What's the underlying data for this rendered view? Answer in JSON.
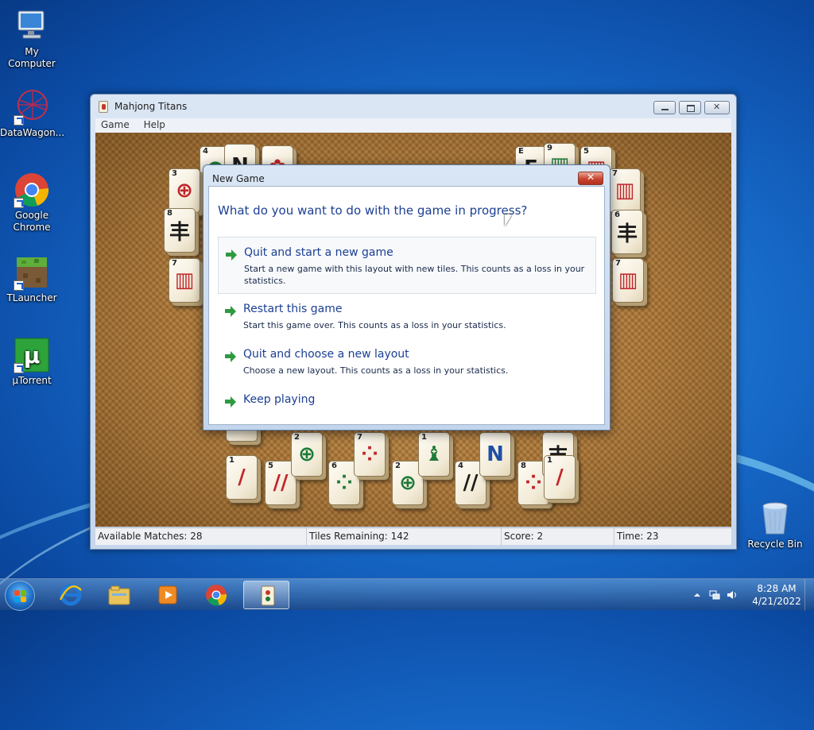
{
  "desktop": {
    "icons": [
      {
        "label": "My Computer"
      },
      {
        "label": "DataWagon..."
      },
      {
        "label": "Google Chrome"
      },
      {
        "label": "TLauncher"
      },
      {
        "label": "µTorrent"
      },
      {
        "label": "Recycle Bin"
      }
    ]
  },
  "window": {
    "title": "Mahjong Titans",
    "menu": [
      "Game",
      "Help"
    ]
  },
  "board": {
    "tiles": [
      {
        "num": "4",
        "glyph": "●",
        "color": "t-green"
      },
      {
        "num": "",
        "glyph": "N",
        "color": "t-black"
      },
      {
        "num": "",
        "glyph": "✿",
        "color": "t-red"
      },
      {
        "num": "3",
        "glyph": "⊕",
        "color": "t-red"
      },
      {
        "num": "8",
        "glyph": "丰",
        "color": "t-black"
      },
      {
        "num": "7",
        "glyph": "▥",
        "color": "t-red"
      },
      {
        "num": "E",
        "glyph": "E",
        "color": "t-black"
      },
      {
        "num": "9",
        "glyph": "▥",
        "color": "t-green"
      },
      {
        "num": "5",
        "glyph": "▥",
        "color": "t-red"
      },
      {
        "num": "7",
        "glyph": "▥",
        "color": "t-red"
      },
      {
        "num": "6",
        "glyph": "丰",
        "color": "t-black"
      },
      {
        "num": "7",
        "glyph": "▥",
        "color": "t-red"
      },
      {
        "num": "",
        "glyph": "▥",
        "color": "t-red"
      },
      {
        "num": "1",
        "glyph": "/",
        "color": "t-red"
      },
      {
        "num": "5",
        "glyph": "//",
        "color": "t-red"
      },
      {
        "num": "2",
        "glyph": "⊕",
        "color": "t-green"
      },
      {
        "num": "6",
        "glyph": "⁘",
        "color": "t-green"
      },
      {
        "num": "7",
        "glyph": "⁘",
        "color": "t-red"
      },
      {
        "num": "2",
        "glyph": "⊕",
        "color": "t-green"
      },
      {
        "num": "1",
        "glyph": "♝",
        "color": "t-green"
      },
      {
        "num": "4",
        "glyph": "//",
        "color": "t-black"
      },
      {
        "num": "",
        "glyph": "N",
        "color": "t-blue"
      },
      {
        "num": "8",
        "glyph": "⁘",
        "color": "t-red"
      },
      {
        "num": "",
        "glyph": "丰",
        "color": "t-black"
      },
      {
        "num": "1",
        "glyph": "/",
        "color": "t-red"
      }
    ]
  },
  "status": {
    "matches": "Available Matches: 28",
    "remaining": "Tiles Remaining: 142",
    "score": "Score: 2",
    "time": "Time: 23"
  },
  "dialog": {
    "title": "New Game",
    "question": "What do you want to do with the game in progress?",
    "options": [
      {
        "label": "Quit and start a new game",
        "desc": "Start a new game with this layout with new tiles. This counts as a loss in your statistics."
      },
      {
        "label": "Restart this game",
        "desc": "Start this game over. This counts as a loss in your statistics."
      },
      {
        "label": "Quit and choose a new layout",
        "desc": "Choose a new layout. This counts as a loss in your statistics."
      },
      {
        "label": "Keep playing",
        "desc": ""
      }
    ]
  },
  "taskbar": {
    "time": "8:28 AM",
    "date": "4/21/2022",
    "items": [
      {
        "icon": "internet-explorer-icon"
      },
      {
        "icon": "file-explorer-icon"
      },
      {
        "icon": "media-player-icon"
      },
      {
        "icon": "chrome-icon"
      },
      {
        "icon": "mahjong-titans-icon"
      }
    ]
  }
}
